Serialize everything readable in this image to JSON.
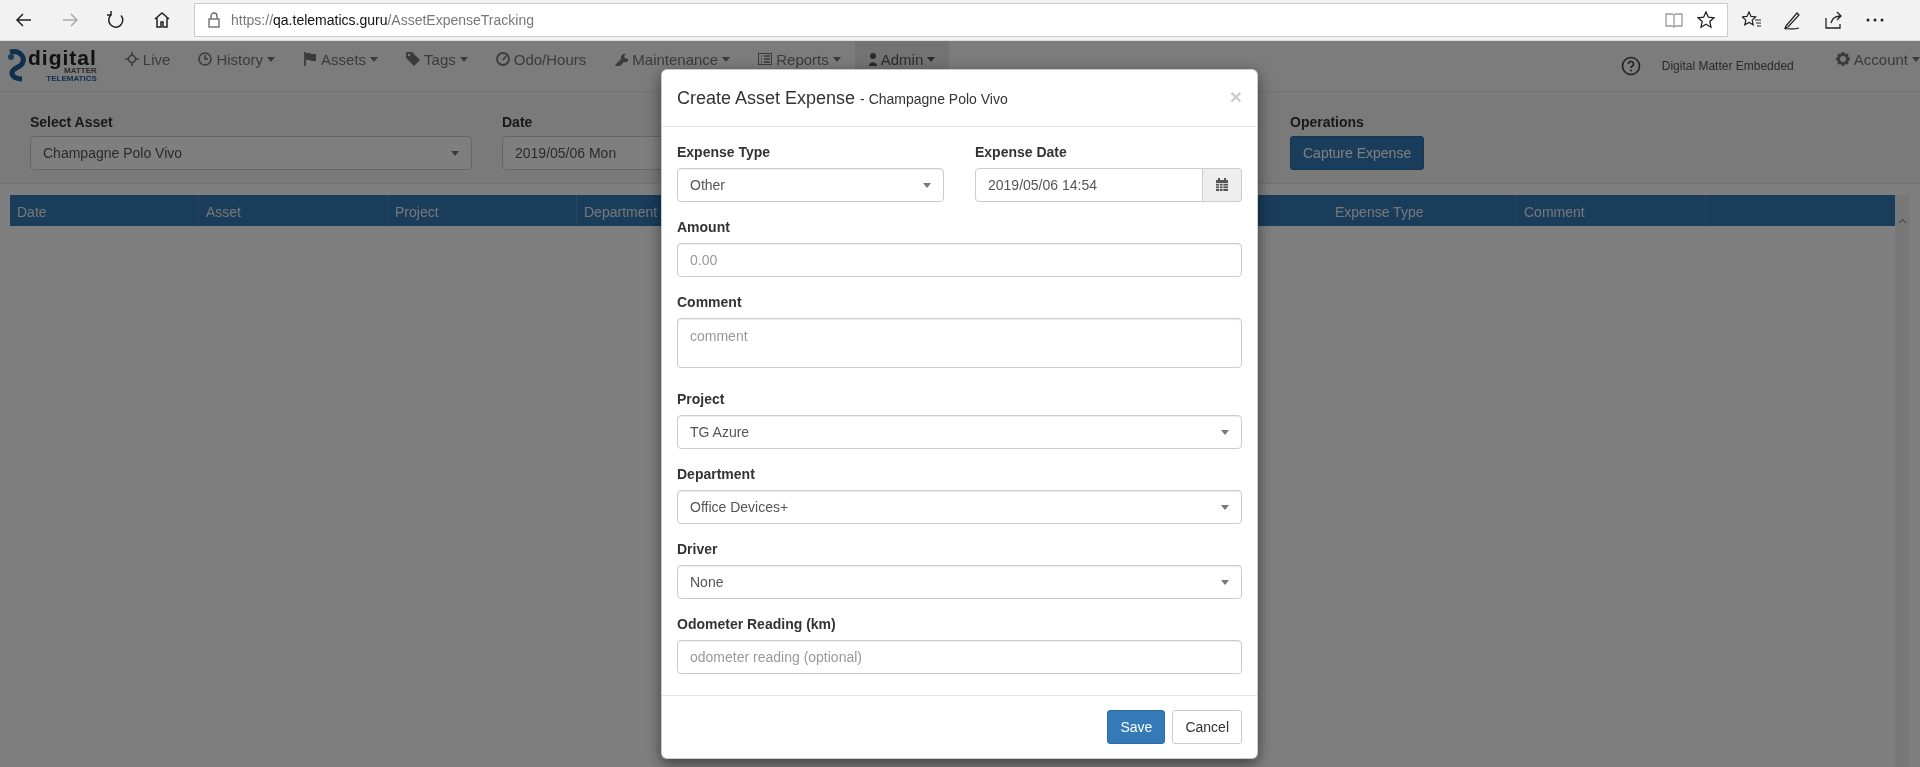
{
  "browser": {
    "url": {
      "scheme": "https://",
      "host": "qa.telematics.guru",
      "path": "/AssetExpenseTracking"
    }
  },
  "navbar": {
    "logo": {
      "word": "digital",
      "line_1": "MATTER",
      "line_2": "TELEMATICS"
    },
    "items": [
      {
        "label": "Live",
        "dropdown": false,
        "selected": false
      },
      {
        "label": "History",
        "dropdown": true,
        "selected": false
      },
      {
        "label": "Assets",
        "dropdown": true,
        "selected": false
      },
      {
        "label": "Tags",
        "dropdown": true,
        "selected": false
      },
      {
        "label": "Odo/Hours",
        "dropdown": false,
        "selected": false
      },
      {
        "label": "Maintenance",
        "dropdown": true,
        "selected": false
      },
      {
        "label": "Reports",
        "dropdown": true,
        "selected": false
      },
      {
        "label": "Admin",
        "dropdown": true,
        "selected": true
      }
    ],
    "organisation": "Digital Matter Embedded",
    "account": {
      "label": "Account",
      "dropdown": true
    }
  },
  "filters": {
    "asset": {
      "label": "Select Asset",
      "value": "Champagne Polo Vivo"
    },
    "date": {
      "label": "Date",
      "value": "2019/05/06 Mon"
    },
    "operations": {
      "label": "Operations",
      "button": "Capture Expense"
    }
  },
  "table": {
    "columns_left": [
      "Date",
      "Asset",
      "Project",
      "Department"
    ],
    "columns_right": [
      "Expense Type",
      "Comment"
    ]
  },
  "modal": {
    "title": "Create Asset Expense",
    "subtitle": "- Champagne Polo Vivo",
    "close": "×",
    "rows": [
      [
        {
          "kind": "select",
          "label": "Expense Type",
          "value": "Other"
        },
        {
          "kind": "date",
          "label": "Expense Date",
          "value": "2019/05/06 14:54"
        }
      ],
      [
        {
          "kind": "input",
          "label": "Amount",
          "placeholder": "0.00"
        }
      ],
      [
        {
          "kind": "textarea",
          "label": "Comment",
          "placeholder": "comment"
        }
      ],
      [
        {
          "kind": "select",
          "label": "Project",
          "value": "TG Azure"
        }
      ],
      [
        {
          "kind": "select",
          "label": "Department",
          "value": "Office Devices+"
        }
      ],
      [
        {
          "kind": "select",
          "label": "Driver",
          "value": "None"
        }
      ],
      [
        {
          "kind": "input",
          "label": "Odometer Reading (km)",
          "placeholder": "odometer reading (optional)"
        }
      ]
    ],
    "buttons": [
      {
        "label": "Save",
        "kind": "primary"
      },
      {
        "label": "Cancel",
        "kind": "default"
      }
    ]
  }
}
